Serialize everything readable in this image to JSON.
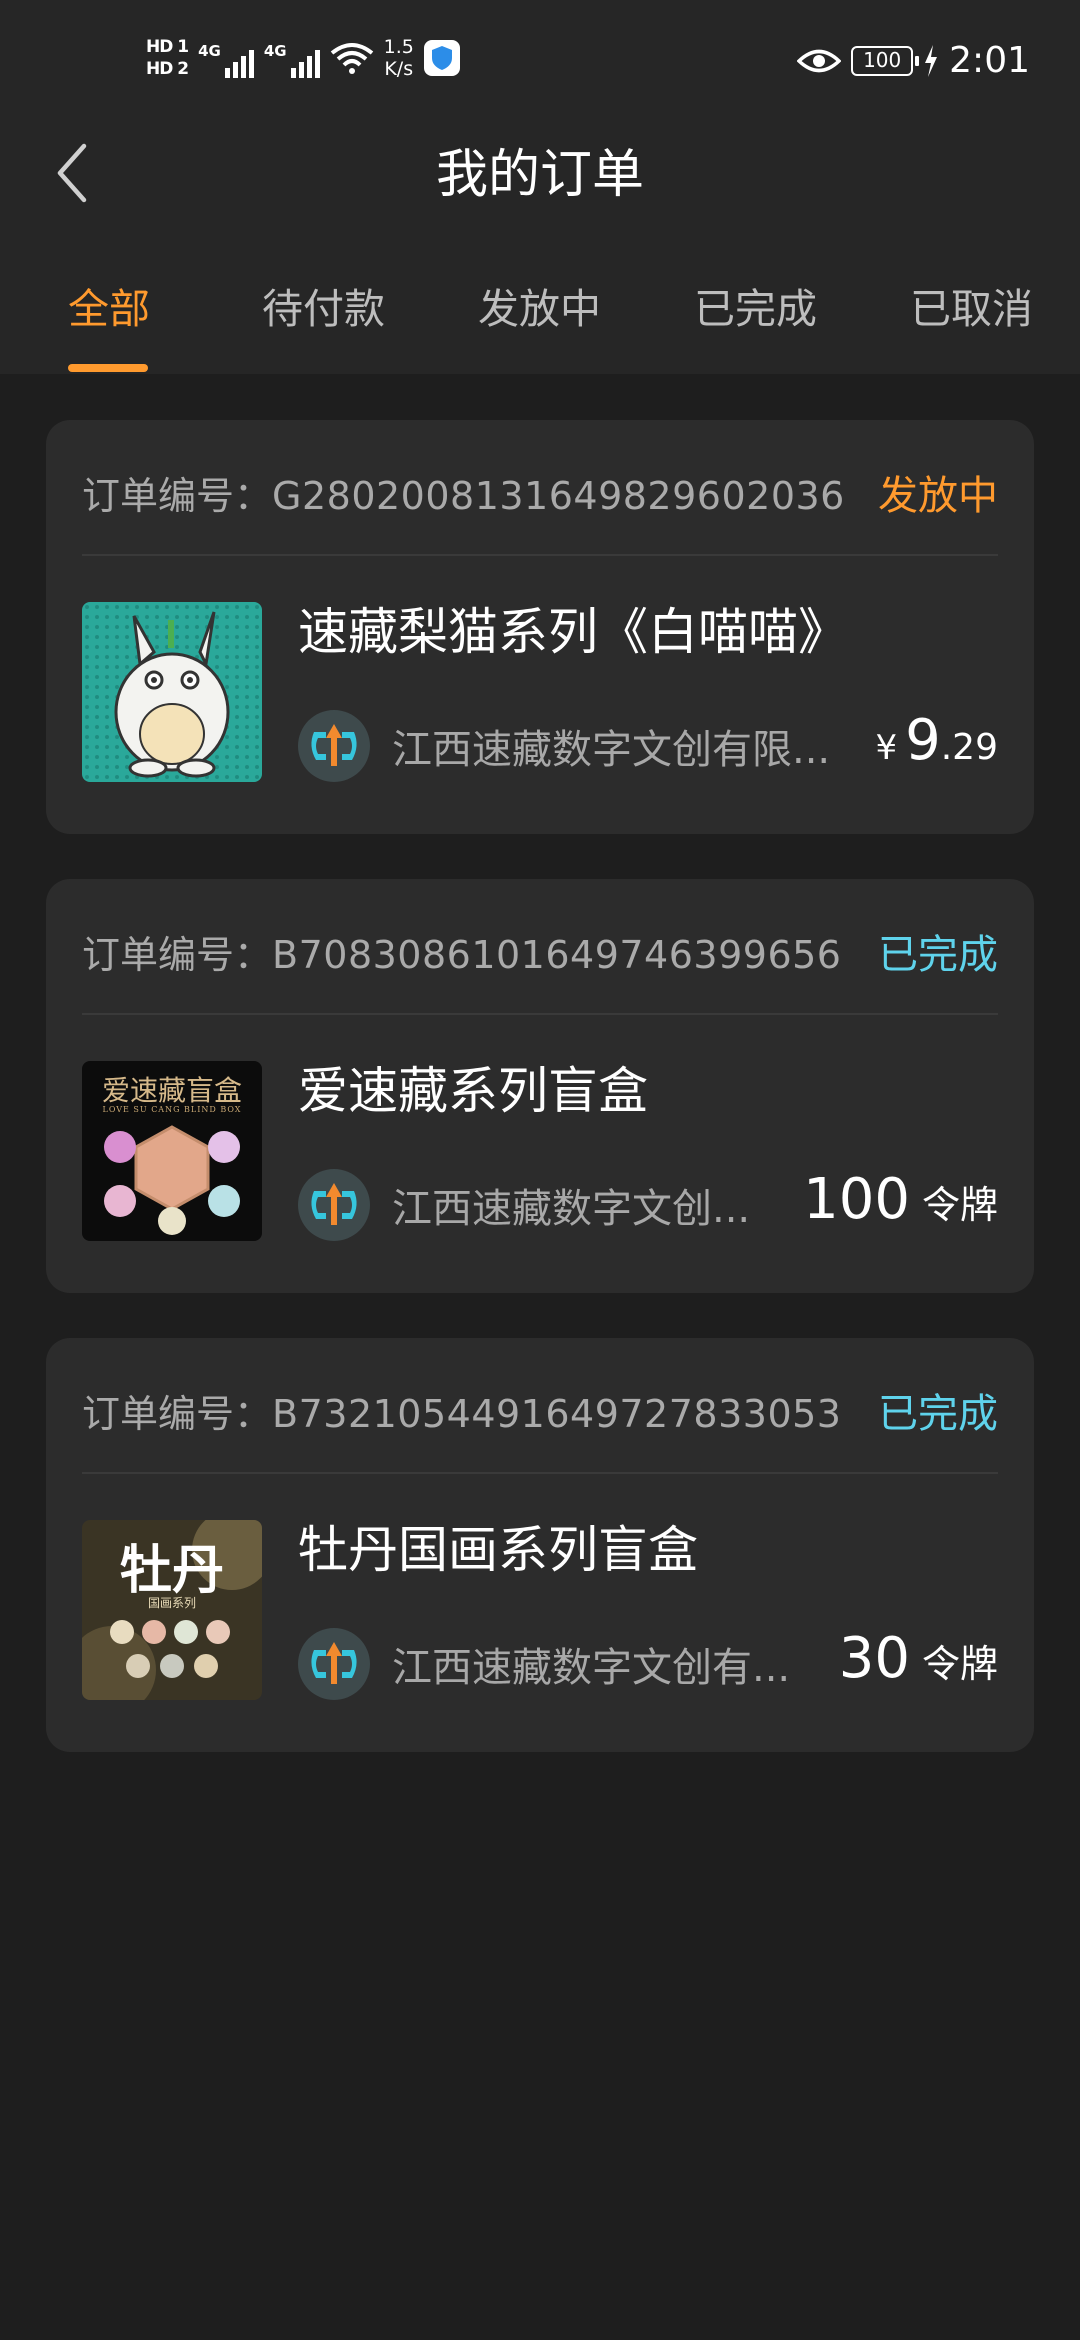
{
  "status_bar": {
    "hd1": "HD",
    "hd2": "HD",
    "sim1": "1",
    "sim2": "2",
    "net1": "4G",
    "net2": "4G",
    "speed_value": "1.5",
    "speed_unit": "K/s",
    "battery": "100",
    "time": "2:01"
  },
  "header": {
    "title": "我的订单"
  },
  "tabs": [
    {
      "label": "全部",
      "active": true
    },
    {
      "label": "待付款",
      "active": false
    },
    {
      "label": "发放中",
      "active": false
    },
    {
      "label": "已完成",
      "active": false
    },
    {
      "label": "已取消",
      "active": false
    }
  ],
  "orders": [
    {
      "order_label": "订单编号：",
      "order_no": "G2802008131649829602036",
      "status": "发放中",
      "status_color": "#ff9a2e",
      "title": "速藏梨猫系列《白喵喵》",
      "issuer": "江西速藏数字文创有限...",
      "price_currency": "¥",
      "price_int": "9",
      "price_dec": ".29",
      "thumb_icon": "white-cat-icon"
    },
    {
      "order_label": "订单编号：",
      "order_no": "B7083086101649746399656",
      "status": "已完成",
      "status_color": "#5fd3ec",
      "title": "爱速藏系列盲盒",
      "issuer": "江西速藏数字文创...",
      "price_value": "100",
      "price_unit": "令牌",
      "thumb_text": "爱速藏盲盒",
      "thumb_sub": "LOVE SU CANG BLIND BOX"
    },
    {
      "order_label": "订单编号：",
      "order_no": "B7321054491649727833053",
      "status": "已完成",
      "status_color": "#5fd3ec",
      "title": "牡丹国画系列盲盒",
      "issuer": "江西速藏数字文创有...",
      "price_value": "30",
      "price_unit": "令牌",
      "thumb_text": "牡丹",
      "thumb_sub": "国画系列"
    }
  ]
}
